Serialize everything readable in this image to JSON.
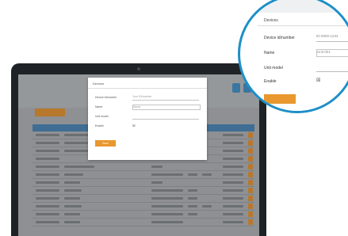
{
  "modal": {
    "title": "Devices",
    "fields": [
      {
        "label": "Device id/number",
        "value": "Your ID/number"
      },
      {
        "label": "Name",
        "value": "Name"
      },
      {
        "label": "Unit model",
        "value": ""
      },
      {
        "label": "Enable",
        "value": ""
      }
    ],
    "enable_checkbox": "☒",
    "save_label": "Save"
  },
  "bubble": {
    "title": "Devices",
    "fields": [
      {
        "label": "Device id/number",
        "value": "ID-0000-1234"
      },
      {
        "label": "Name",
        "value": "Unit 001"
      },
      {
        "label": "Unit model",
        "value": ""
      },
      {
        "label": "Enable",
        "value": ""
      }
    ],
    "enable_checkbox": "☒",
    "save_label": ""
  },
  "colors": {
    "accent_orange": "#e8982e",
    "table_header_blue": "#3f6d94",
    "bubble_border": "#1d8fc7",
    "laptop_bezel": "#1f2226"
  },
  "icons": [
    "camera-icon",
    "grid-icon",
    "settings-icon"
  ]
}
